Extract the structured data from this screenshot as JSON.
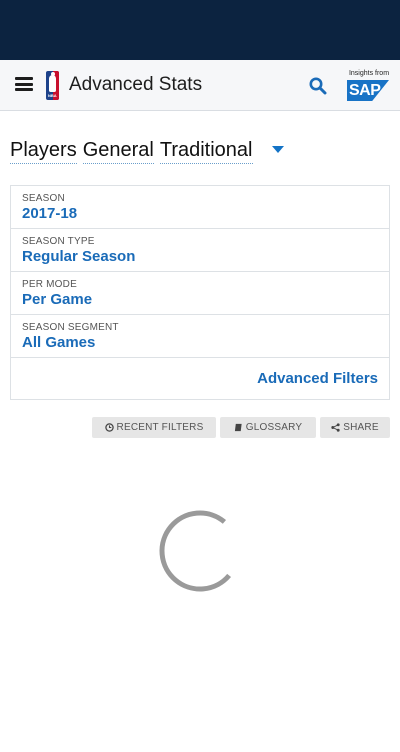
{
  "header": {
    "title": "Advanced Stats",
    "logo_text": "NBA",
    "sponsor_small": "Insights from",
    "sponsor_brand": "SAP"
  },
  "query": {
    "parts": [
      "Players",
      "General",
      "Traditional"
    ]
  },
  "filters": [
    {
      "label": "SEASON",
      "value": "2017-18"
    },
    {
      "label": "SEASON TYPE",
      "value": "Regular Season"
    },
    {
      "label": "PER MODE",
      "value": "Per Game"
    },
    {
      "label": "SEASON SEGMENT",
      "value": "All Games"
    }
  ],
  "advanced_filters_label": "Advanced Filters",
  "actions": {
    "recent_filters": "RECENT FILTERS",
    "glossary": "GLOSSARY",
    "share": "SHARE"
  },
  "colors": {
    "topbar": "#0c2340",
    "accent": "#1a6bb8",
    "spinner": "#9a9a9a"
  }
}
